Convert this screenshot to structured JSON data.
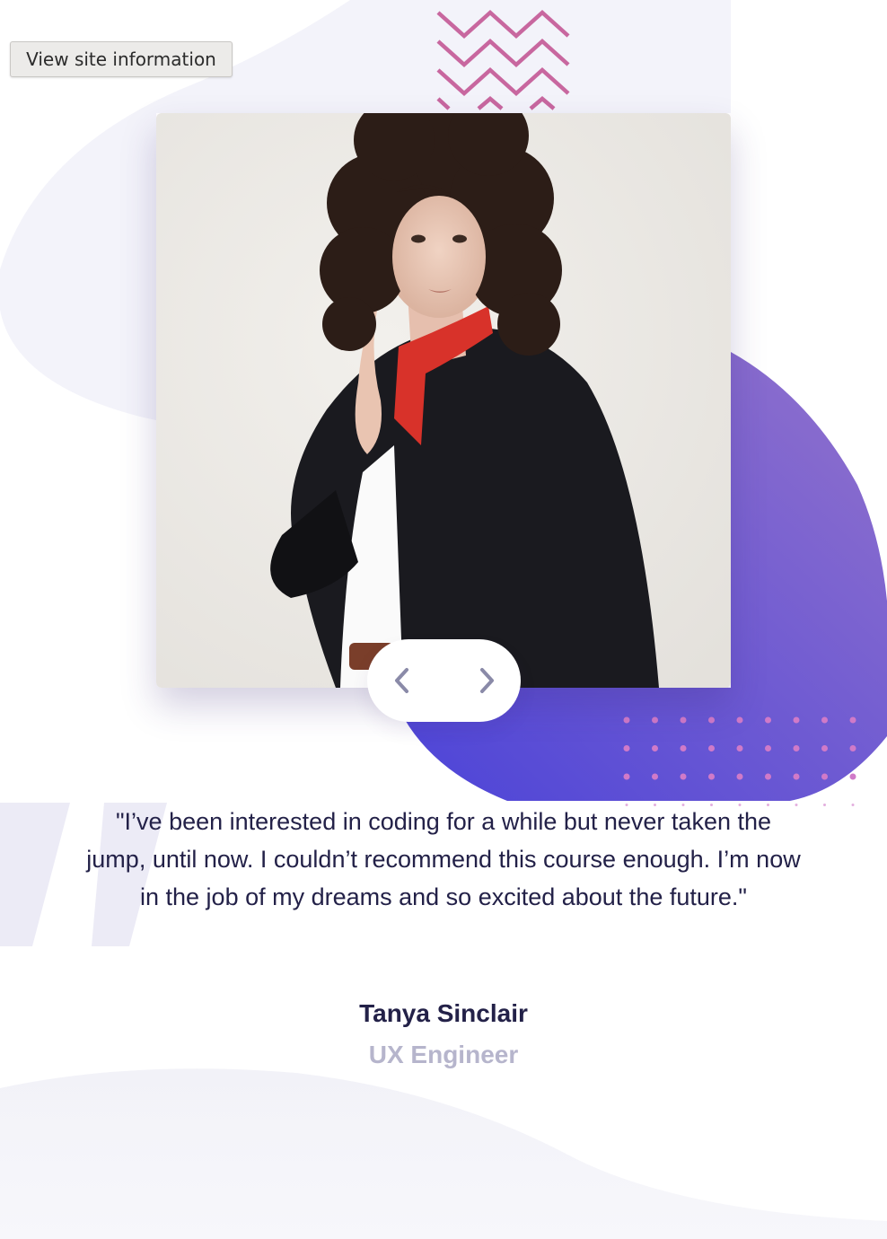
{
  "browser": {
    "site_info_label": "View site information"
  },
  "testimonial": {
    "quote": "\"I’ve been interested in coding for a while but never taken the jump, until now. I couldn’t recommend this course enough. I’m now in the job of my dreams and so excited about the future.\"",
    "author": "Tanya Sinclair",
    "role": "UX Engineer"
  },
  "navigation": {
    "prev_icon": "chevron-left-icon",
    "next_icon": "chevron-right-icon"
  },
  "colors": {
    "text_dark": "#232148",
    "text_muted": "#b6b5cc",
    "accent_purple": "#8b6fd0",
    "accent_indigo": "#4c44d8",
    "zigzag_pink": "#c8679f",
    "background_blob": "#f3f3fa"
  }
}
